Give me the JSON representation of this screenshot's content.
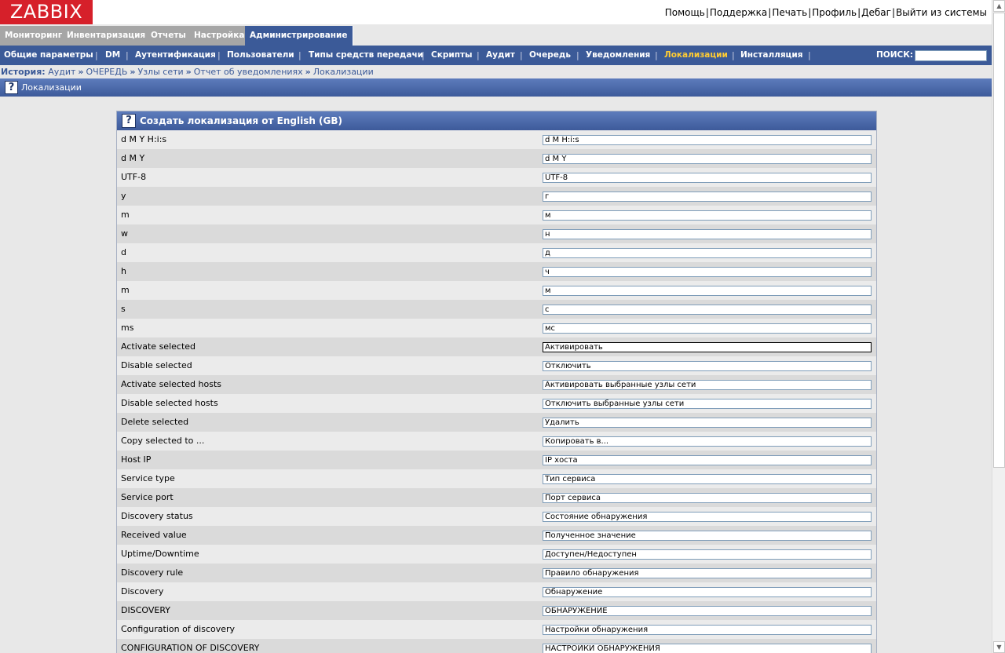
{
  "logo": "ZABBIX",
  "top_links": [
    "Помощь",
    "Поддержка",
    "Печать",
    "Профиль",
    "Дебаг",
    "Выйти из системы"
  ],
  "top_link_separator": "|",
  "main_tabs": [
    "Мониторинг",
    "Инвентаризация",
    "Отчеты",
    "Настройка",
    "Администрирование"
  ],
  "active_main_tab": "Администрирование",
  "sub_menu": [
    "Общие параметры",
    "DM",
    "Аутентификация",
    "Пользователи",
    "Типы средств передачи",
    "Скрипты",
    "Аудит",
    "Очередь",
    "Уведомления",
    "Локализации",
    "Инсталляция"
  ],
  "sub_menu_separator": "|",
  "active_sub_menu": "Локализации",
  "search_label": "ПОИСК:",
  "search_value": "",
  "history": {
    "label": "История:",
    "arrow": "»",
    "items": [
      "Аудит",
      "ОЧЕРЕДЬ",
      "Узлы сети",
      "Отчет об уведомлениях",
      "Локализации"
    ]
  },
  "page_title": "Локализации",
  "help_icon": "?",
  "form_title": "Создать локализация от English (GB)",
  "rows": [
    {
      "label": "d M Y H:i:s",
      "value": "d M H:i:s"
    },
    {
      "label": "d M Y",
      "value": "d M Y"
    },
    {
      "label": "UTF-8",
      "value": "UTF-8"
    },
    {
      "label": "y",
      "value": "г"
    },
    {
      "label": "m",
      "value": "м"
    },
    {
      "label": "w",
      "value": "н"
    },
    {
      "label": "d",
      "value": "д"
    },
    {
      "label": "h",
      "value": "ч"
    },
    {
      "label": "m",
      "value": "м"
    },
    {
      "label": "s",
      "value": "с"
    },
    {
      "label": "ms",
      "value": "мс"
    },
    {
      "label": "Activate selected",
      "value": "Активировать"
    },
    {
      "label": "Disable selected",
      "value": "Отключить"
    },
    {
      "label": "Activate selected hosts",
      "value": "Активировать выбранные узлы сети"
    },
    {
      "label": "Disable selected hosts",
      "value": "Отключить выбранные узлы сети"
    },
    {
      "label": "Delete selected",
      "value": "Удалить"
    },
    {
      "label": "Copy selected to ...",
      "value": "Копировать в..."
    },
    {
      "label": "Host IP",
      "value": "IP хоста"
    },
    {
      "label": "Service type",
      "value": "Тип сервиса"
    },
    {
      "label": "Service port",
      "value": "Порт сервиса"
    },
    {
      "label": "Discovery status",
      "value": "Состояние обнаружения"
    },
    {
      "label": "Received value",
      "value": "Полученное значение"
    },
    {
      "label": "Uptime/Downtime",
      "value": "Доступен/Недоступен"
    },
    {
      "label": "Discovery rule",
      "value": "Правило обнаружения"
    },
    {
      "label": "Discovery",
      "value": "Обнаружение"
    },
    {
      "label": "DISCOVERY",
      "value": "ОБНАРУЖЕНИЕ"
    },
    {
      "label": "Configuration of discovery",
      "value": "Настройки обнаружения"
    },
    {
      "label": "CONFIGURATION OF DISCOVERY",
      "value": "НАСТРОЙКИ ОБНАРУЖЕНИЯ"
    }
  ],
  "focused_row_label": "Activate selected",
  "colors": {
    "logo_bg": "#d6202a",
    "nav_blue": "#3b5a98",
    "inactive_tab": "#a6a6a6",
    "active_submenu_text": "#ffcc33",
    "row_odd": "#ebebeb",
    "row_even": "#dadada"
  }
}
